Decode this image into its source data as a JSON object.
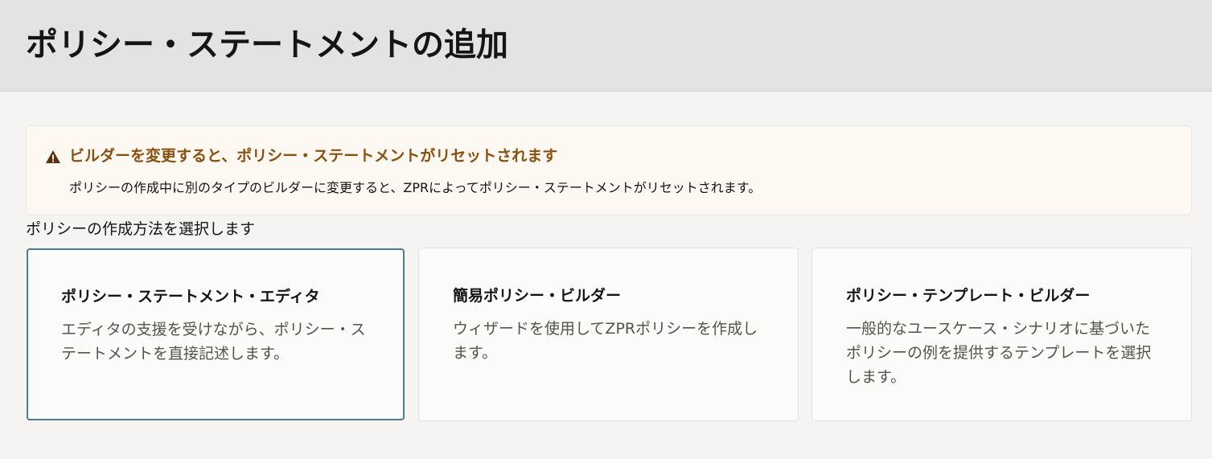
{
  "header": {
    "title": "ポリシー・ステートメントの追加"
  },
  "warning": {
    "icon": "warning-triangle-icon",
    "title": "ビルダーを変更すると、ポリシー・ステートメントがリセットされます",
    "body": "ポリシーの作成中に別のタイプのビルダーに変更すると、ZPRによってポリシー・ステートメントがリセットされます。",
    "color": "#8a5010"
  },
  "selection": {
    "label": "ポリシーの作成方法を選択します",
    "selected_index": 0,
    "options": [
      {
        "title": "ポリシー・ステートメント・エディタ",
        "description": "エディタの支援を受けながら、ポリシー・ステートメントを直接記述します。"
      },
      {
        "title": "簡易ポリシー・ビルダー",
        "description": "ウィザードを使用してZPRポリシーを作成します。"
      },
      {
        "title": "ポリシー・テンプレート・ビルダー",
        "description": "一般的なユースケース・シナリオに基づいたポリシーの例を提供するテンプレートを選択します。"
      }
    ]
  },
  "colors": {
    "selected_border": "#4a7b97"
  }
}
